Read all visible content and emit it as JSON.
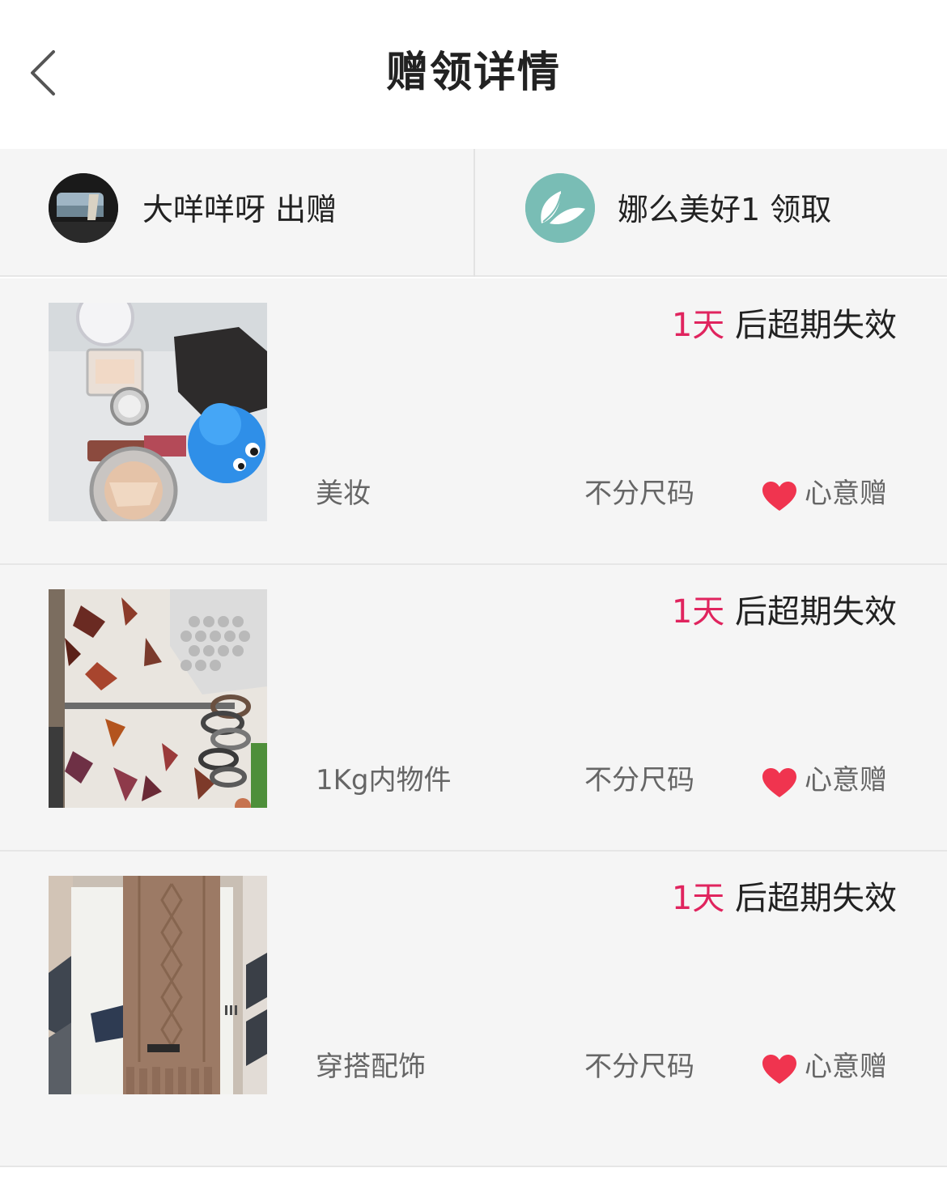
{
  "header": {
    "title": "赠领详情",
    "back_icon": "chevron-left-icon"
  },
  "parties": {
    "giver": {
      "name": "大咩咩呀",
      "action": "出赠",
      "label": "大咩咩呀 出赠"
    },
    "receiver": {
      "name": "娜么美好1",
      "action": "领取",
      "label": "娜么美好1 领取"
    }
  },
  "items": [
    {
      "expiry_days": "1天",
      "expiry_suffix": " 后超期失效",
      "category": "美妆",
      "size": "不分尺码",
      "gift_type": "心意赠",
      "image": "cosmetics-photo"
    },
    {
      "expiry_days": "1天",
      "expiry_suffix": " 后超期失效",
      "category": "1Kg内物件",
      "size": "不分尺码",
      "gift_type": "心意赠",
      "image": "dried-flowers-rings-photo"
    },
    {
      "expiry_days": "1天",
      "expiry_suffix": " 后超期失效",
      "category": "穿搭配饰",
      "size": "不分尺码",
      "gift_type": "心意赠",
      "image": "knit-scarf-photo"
    }
  ],
  "colors": {
    "accent_red": "#e0245e",
    "heart": "#f0344f",
    "background": "#f5f5f5",
    "divider": "#e6e6e6"
  }
}
